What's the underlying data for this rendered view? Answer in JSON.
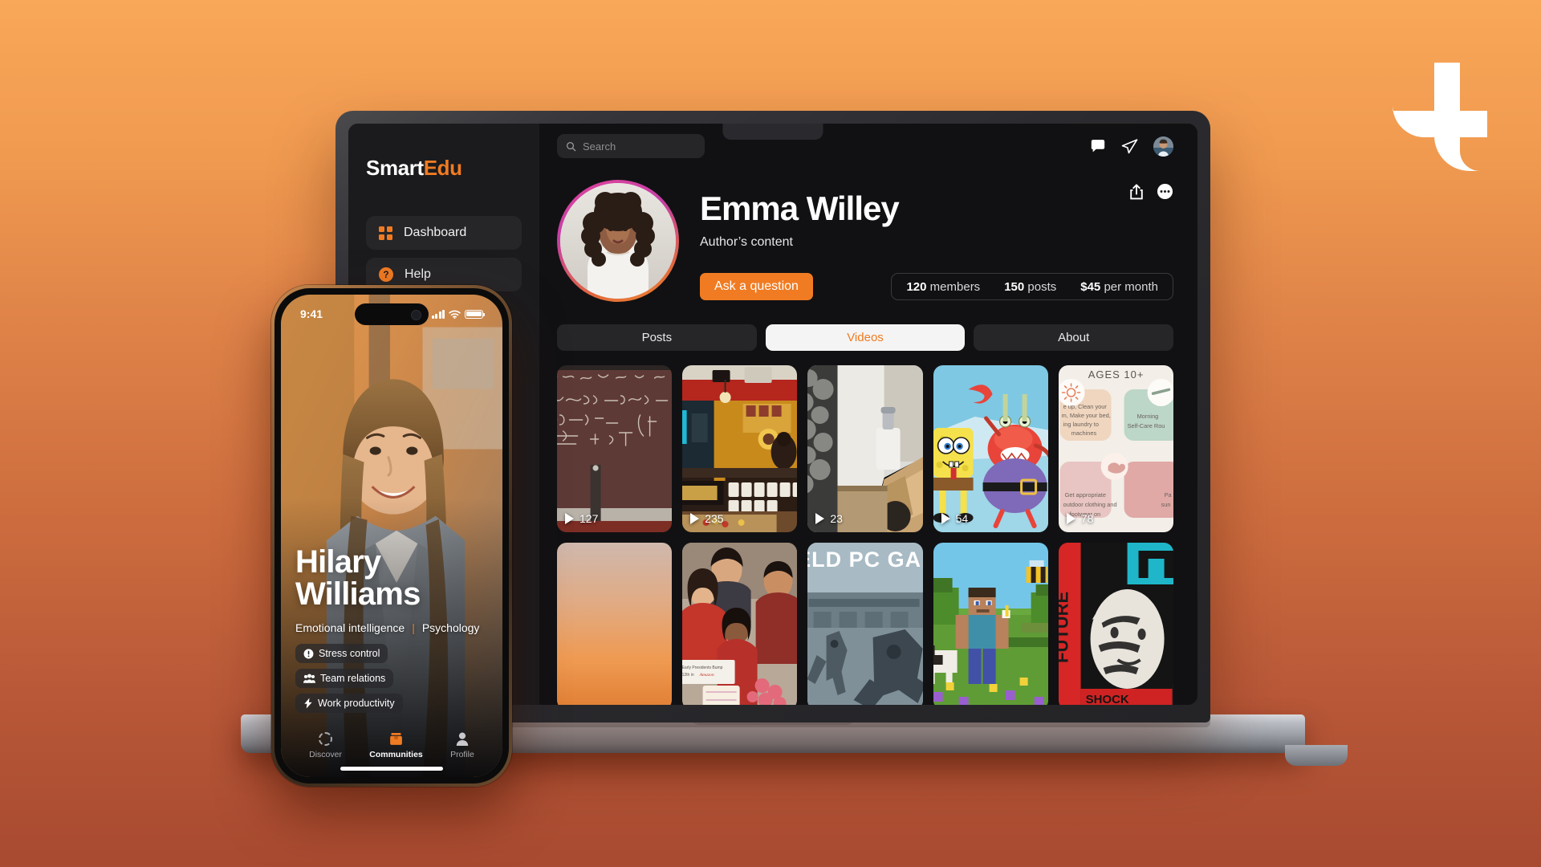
{
  "brand": {
    "mark_name": "t-logo-mark",
    "accent": "#F07B22"
  },
  "background": {
    "top_color": "#F9A758",
    "bottom_color": "#A84A30"
  },
  "laptop": {
    "sidebar": {
      "logo_primary": "Smart",
      "logo_accent": "Edu",
      "items": [
        {
          "label": "Dashboard",
          "icon": "grid-icon"
        },
        {
          "label": "Help",
          "icon": "question-circle-icon"
        }
      ]
    },
    "topbar": {
      "search_placeholder": "Search",
      "search_value": "",
      "icons": [
        "chat-bubble-icon",
        "paper-plane-icon",
        "account-avatar"
      ]
    },
    "profile": {
      "name": "Emma Willey",
      "subtitle": "Author’s content",
      "cta_label": "Ask a question",
      "actions": [
        "share-icon",
        "more-options-icon"
      ],
      "stats": [
        {
          "value": "120",
          "label": "members"
        },
        {
          "value": "150",
          "label": "posts"
        },
        {
          "value": "$45",
          "label": "per month"
        }
      ]
    },
    "tabs": [
      {
        "label": "Posts",
        "active": false
      },
      {
        "label": "Videos",
        "active": true
      },
      {
        "label": "About",
        "active": false
      }
    ],
    "videos": [
      {
        "views": "127",
        "alt": "chalkboard-equations"
      },
      {
        "views": "235",
        "alt": "coffee-shop-interior"
      },
      {
        "views": "23",
        "alt": "soap-dispenser-kitchen"
      },
      {
        "views": "54",
        "alt": "cartoon-characters"
      },
      {
        "views": "78",
        "alt": "self-care-routine-chart",
        "overlay_title": "AGES 10+",
        "overlay_texts": [
          "Morning Self-Care Rou",
          "Get appropriate outdoor clothing and footwear on",
          "e up, Clean your m, Make your bed, ing laundry to machines"
        ]
      },
      {
        "views": "",
        "alt": "sunset-gradient-sky"
      },
      {
        "views": "",
        "alt": "family-group-photo"
      },
      {
        "views": "",
        "alt": "pc-game-screenshot",
        "overlay_title": "IELD PC GAM"
      },
      {
        "views": "",
        "alt": "minecraft-gameplay"
      },
      {
        "views": "",
        "alt": "black-white-red-poster"
      }
    ]
  },
  "phone": {
    "status_bar": {
      "time": "9:41",
      "signal": "signal-bars-icon",
      "wifi": "wifi-icon",
      "battery": "battery-full-icon"
    },
    "card": {
      "name_line1": "Hilary",
      "name_line2": "Williams",
      "topic_left": "Emotional intelligence",
      "topic_separator": "|",
      "topic_right": "Psychology",
      "chips": [
        {
          "label": "Stress control",
          "icon": "exclamation-circle-icon"
        },
        {
          "label": "Team relations",
          "icon": "people-group-icon"
        },
        {
          "label": "Work productivity",
          "icon": "lightning-bolt-icon"
        }
      ]
    },
    "nav": [
      {
        "label": "Discover",
        "icon": "dashed-circle-icon",
        "active": false
      },
      {
        "label": "Communities",
        "icon": "communities-icon",
        "active": true
      },
      {
        "label": "Profile",
        "icon": "person-icon",
        "active": false
      }
    ]
  }
}
